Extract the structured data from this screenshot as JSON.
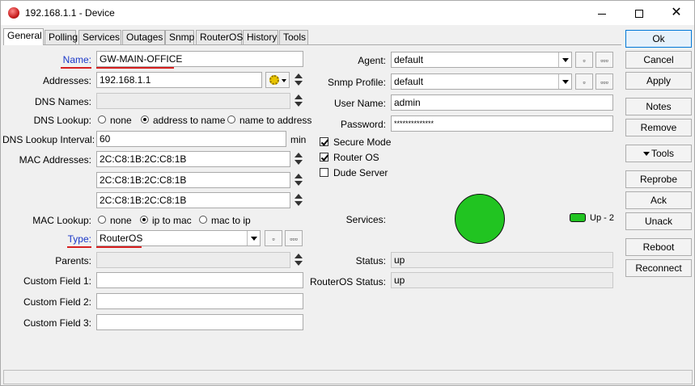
{
  "window": {
    "title": "192.168.1.1 - Device",
    "minimize": "—",
    "maximize": "",
    "close": "✕"
  },
  "tabs": [
    "General",
    "Polling",
    "Services",
    "Outages",
    "Snmp",
    "RouterOS",
    "History",
    "Tools"
  ],
  "general": {
    "name_label": "Name:",
    "name_value": "GW-MAIN-OFFICE",
    "addresses_label": "Addresses:",
    "addresses_value": "192.168.1.1",
    "dns_names_label": "DNS Names:",
    "dns_lookup_label": "DNS Lookup:",
    "dns_lookup_options": [
      "none",
      "address to name",
      "name to address"
    ],
    "dns_lookup_interval_label": "DNS Lookup Interval:",
    "dns_lookup_interval_value": "60",
    "dns_lookup_interval_unit": "min",
    "mac_addresses_label": "MAC Addresses:",
    "mac_addresses": [
      "2C:C8:1B:2C:C8:1B",
      "2C:C8:1B:2C:C8:1B",
      "2C:C8:1B:2C:C8:1B"
    ],
    "mac_lookup_label": "MAC Lookup:",
    "mac_lookup_options": [
      "none",
      "ip to mac",
      "mac to ip"
    ],
    "type_label": "Type:",
    "type_value": "RouterOS",
    "parents_label": "Parents:",
    "custom_field_1_label": "Custom Field 1:",
    "custom_field_2_label": "Custom Field 2:",
    "custom_field_3_label": "Custom Field 3:",
    "agent_label": "Agent:",
    "agent_value": "default",
    "snmp_profile_label": "Snmp Profile:",
    "snmp_profile_value": "default",
    "user_name_label": "User Name:",
    "user_name_value": "admin",
    "password_label": "Password:",
    "password_value": "**************",
    "secure_mode_label": "Secure Mode",
    "router_os_label": "Router OS",
    "dude_server_label": "Dude Server",
    "services_label": "Services:",
    "services_legend": "Up - 2",
    "status_label": "Status:",
    "status_value": "up",
    "routeros_status_label": "RouterOS Status:",
    "routeros_status_value": "up",
    "small_btn_single": "▫",
    "small_btn_multi": "▫▫▫"
  },
  "side_buttons": {
    "ok": "Ok",
    "cancel": "Cancel",
    "apply": "Apply",
    "notes": "Notes",
    "remove": "Remove",
    "tools": "Tools",
    "reprobe": "Reprobe",
    "ack": "Ack",
    "unack": "Unack",
    "reboot": "Reboot",
    "reconnect": "Reconnect"
  },
  "colors": {
    "services_up": "#21c421",
    "link_label": "#1a37c8",
    "highlight_underline": "#d61f1f"
  }
}
